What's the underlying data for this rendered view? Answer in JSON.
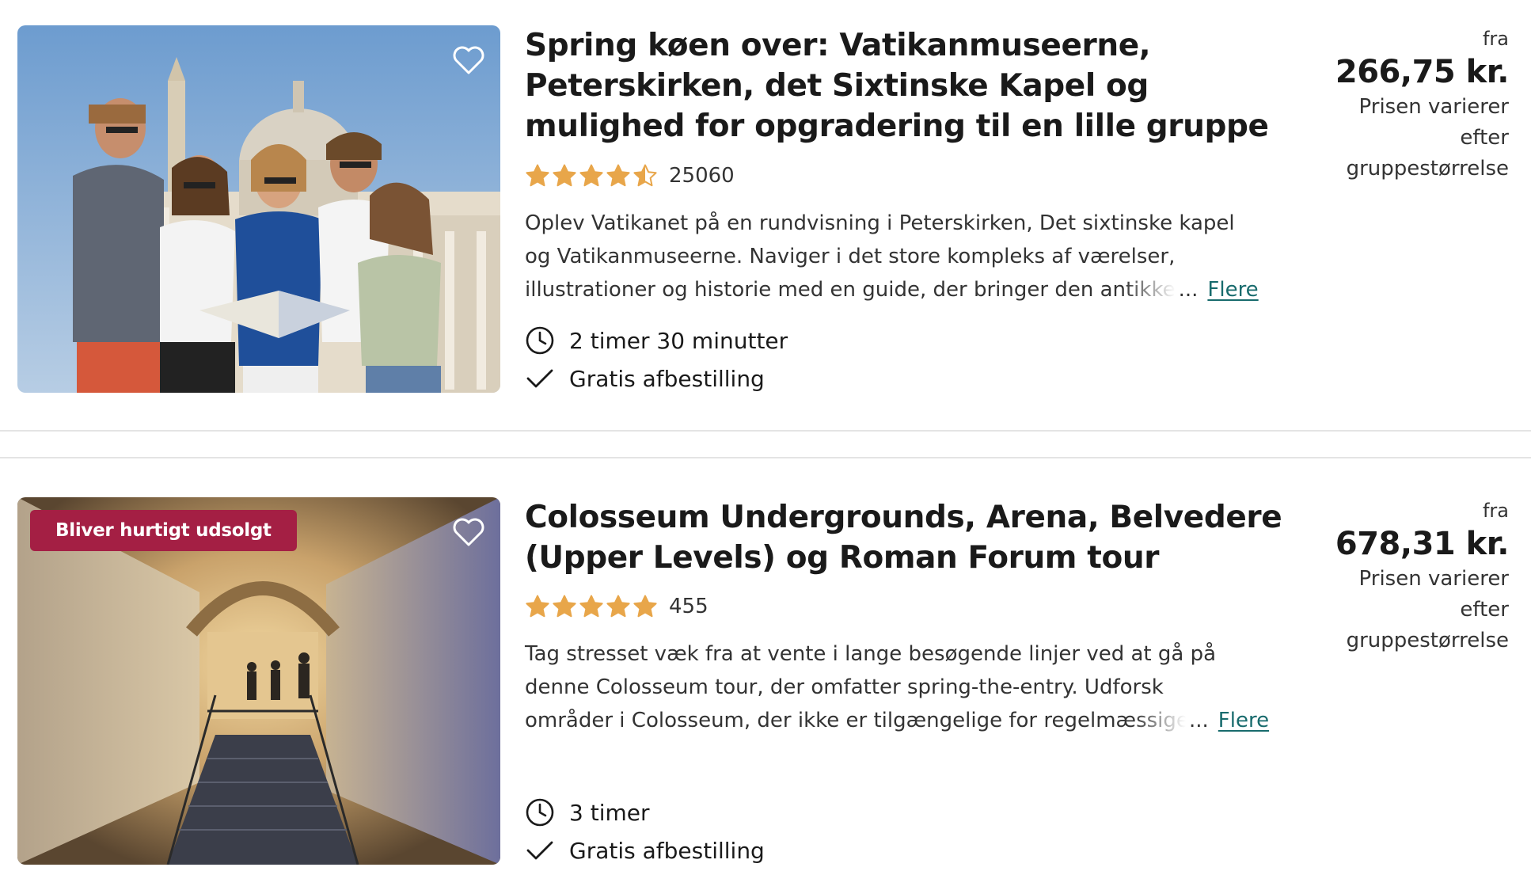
{
  "colors": {
    "star": "#e8a64a",
    "badge": "#a41f44",
    "link": "#186b6d",
    "text": "#1a1a1a",
    "divider": "#e4e4e4"
  },
  "listings": [
    {
      "title": "Spring køen over: Vatikanmuseerne, Peterskirken, det Sixtinske Kapel og mulighed for opgradering til en lille gruppe",
      "rating": 4.5,
      "review_count": "25060",
      "description_lines": [
        "Oplev Vatikanet på en rundvisning i Peterskirken, Det sixtinske kapel",
        "og Vatikanmuseerne. Naviger i det store kompleks af værelser,",
        "illustrationer og historie med en guide, der bringer den antikke"
      ],
      "more_label": "Flere",
      "ellipsis": "...",
      "duration": "2 timer 30 minutter",
      "cancellation": "Gratis afbestilling",
      "price_from": "fra",
      "price": "266,75 kr.",
      "price_note_lines": [
        "Prisen varierer",
        "efter",
        "gruppestørrelse"
      ],
      "image_icon": "vatican-tour-group-photo"
    },
    {
      "badge": "Bliver hurtigt udsolgt",
      "title": "Colosseum Undergrounds, Arena, Belvedere (Upper Levels) og Roman Forum tour",
      "rating": 5,
      "review_count": "455",
      "description_lines": [
        "Tag stresset væk fra at vente i lange besøgende linjer ved at gå på",
        "denne Colosseum tour, der omfatter spring-the-entry. Udforsk",
        "områder i Colosseum, der ikke er tilgængelige for regelmæssige"
      ],
      "more_label": "Flere",
      "ellipsis": "...",
      "duration": "3 timer",
      "cancellation": "Gratis afbestilling",
      "price_from": "fra",
      "price": "678,31 kr.",
      "price_note_lines": [
        "Prisen varierer",
        "efter",
        "gruppestørrelse"
      ],
      "image_icon": "colosseum-underground-corridor-photo"
    }
  ]
}
